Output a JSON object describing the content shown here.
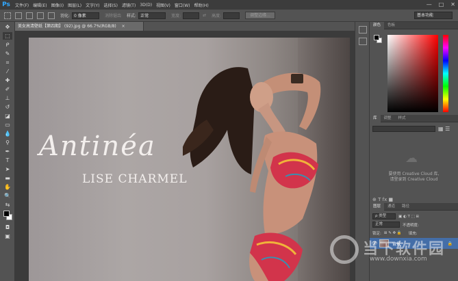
{
  "app": {
    "logo": "Ps",
    "menu": [
      "文件(F)",
      "编辑(E)",
      "图像(I)",
      "图层(L)",
      "文字(Y)",
      "选择(S)",
      "滤镜(T)",
      "3D(D)",
      "视图(V)",
      "窗口(W)",
      "帮助(H)"
    ],
    "window_controls": [
      "—",
      "□",
      "✕"
    ]
  },
  "options": {
    "feather_label": "羽化:",
    "feather_value": "0 像素",
    "antialias_label": "消除锯齿",
    "style_label": "样式:",
    "style_value": "正常",
    "width_label": "宽度:",
    "height_label": "高度:",
    "refine_button": "调整边缘...",
    "workspace": "基本功能"
  },
  "document": {
    "tab_title": "美女高清壁纸【第四期】 (92).jpg @ 66.7%(RGB/8)",
    "close": "×",
    "brand_script": "Antinéa",
    "brand_name": "LISE CHARMEL"
  },
  "panels": {
    "color_tabs": [
      "颜色",
      "色板"
    ],
    "library_tabs": [
      "库",
      "调整",
      "样式"
    ],
    "cc_line1": "要使用 Creative Cloud 库,",
    "cc_line2": "请登录到 Creative Cloud",
    "layers_tabs": [
      "图层",
      "通道",
      "路径"
    ],
    "kind_label": "ρ 类型",
    "blend_mode": "正常",
    "opacity_label": "不透明度:",
    "lock_label": "锁定:",
    "fill_label": "填充:",
    "layer_name": "背景"
  },
  "watermark": {
    "text": "当下软件园",
    "url": "www.downxia.com"
  },
  "colors": {
    "foreground": "#000000",
    "background": "#ffffff",
    "layer_selected": "#446ea8"
  }
}
